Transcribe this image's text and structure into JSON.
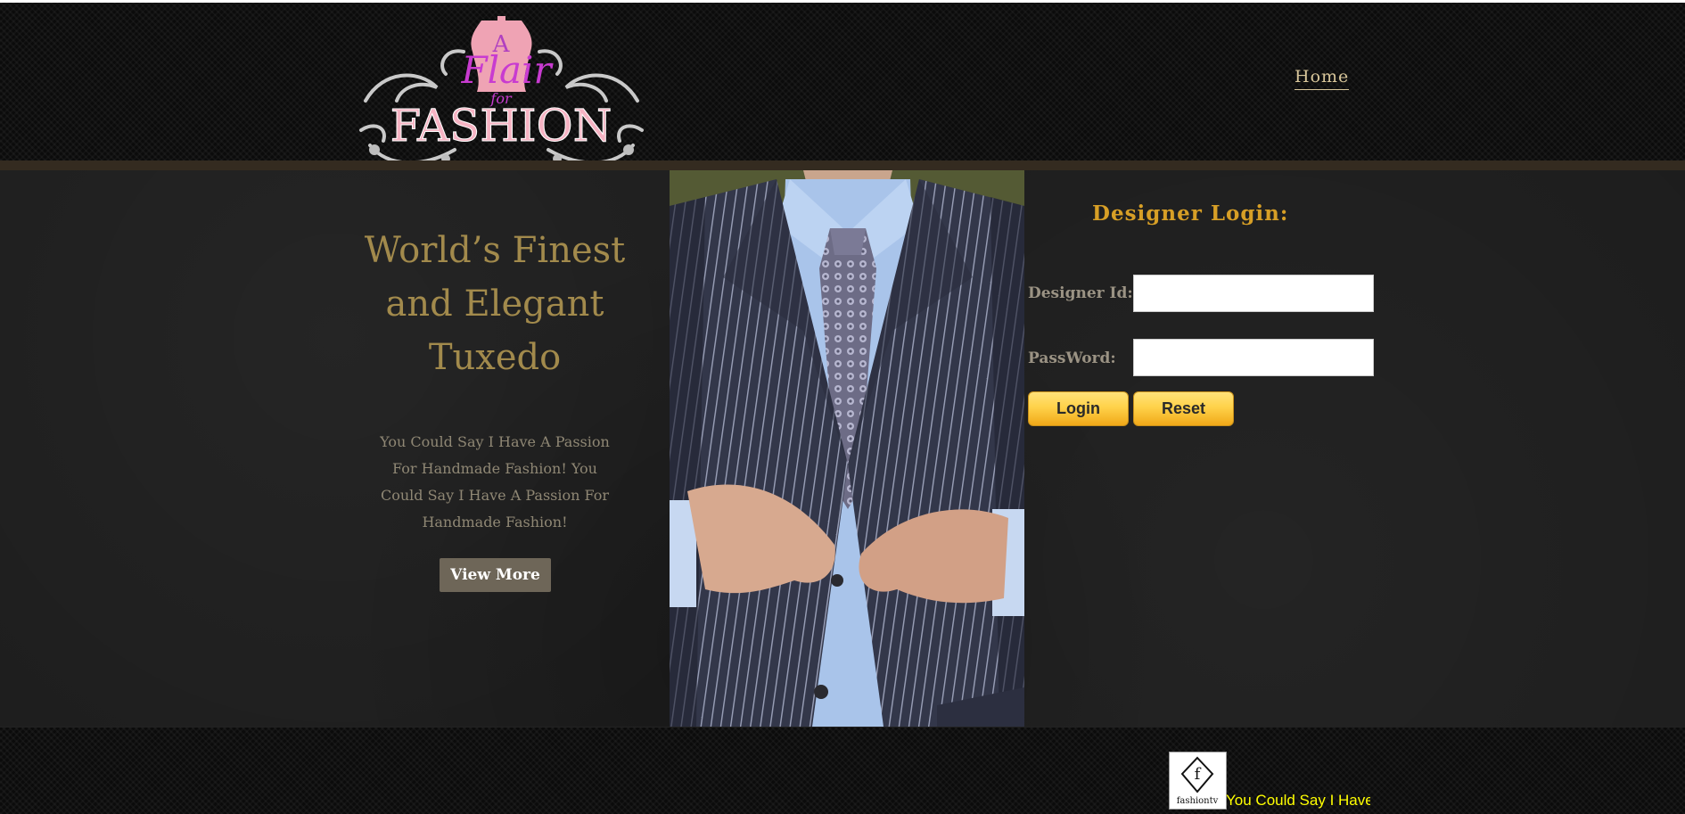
{
  "brand": {
    "logo_line1": "A",
    "logo_line2": "Flair",
    "logo_line3": "for",
    "logo_line4": "FASHION"
  },
  "nav": {
    "home_label": "Home"
  },
  "hero": {
    "title_lines": [
      "World’s Finest",
      "and Elegant",
      "Tuxedo"
    ],
    "text": "You Could Say I Have A Passion For Handmade Fashion! You Could Say I Have A Passion For Handmade Fashion!",
    "button_label": "View More"
  },
  "login": {
    "title": "Designer Login:",
    "designer_id_label": "Designer Id:",
    "designer_id_value": "",
    "password_label": "PassWord:",
    "password_value": "",
    "login_label": "Login",
    "reset_label": "Reset"
  },
  "footer": {
    "logo_text": "fashiontv",
    "marquee_text": "You Could Say I Have"
  },
  "colors": {
    "hero_title": "#a28a4c",
    "login_title": "#d79f26",
    "marquee": "#ffff00",
    "header_band": "#342b20"
  }
}
